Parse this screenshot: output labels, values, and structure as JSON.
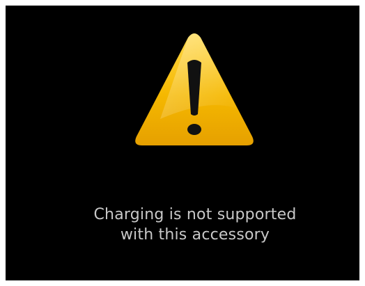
{
  "alert": {
    "icon": "warning-triangle-icon",
    "message_line1": "Charging is not supported",
    "message_line2": "with this accessory"
  },
  "colors": {
    "background": "#000000",
    "text": "#c8c8c8",
    "icon_fill": "#f5b800",
    "icon_highlight": "#ffd84a",
    "icon_mark": "#111111"
  }
}
